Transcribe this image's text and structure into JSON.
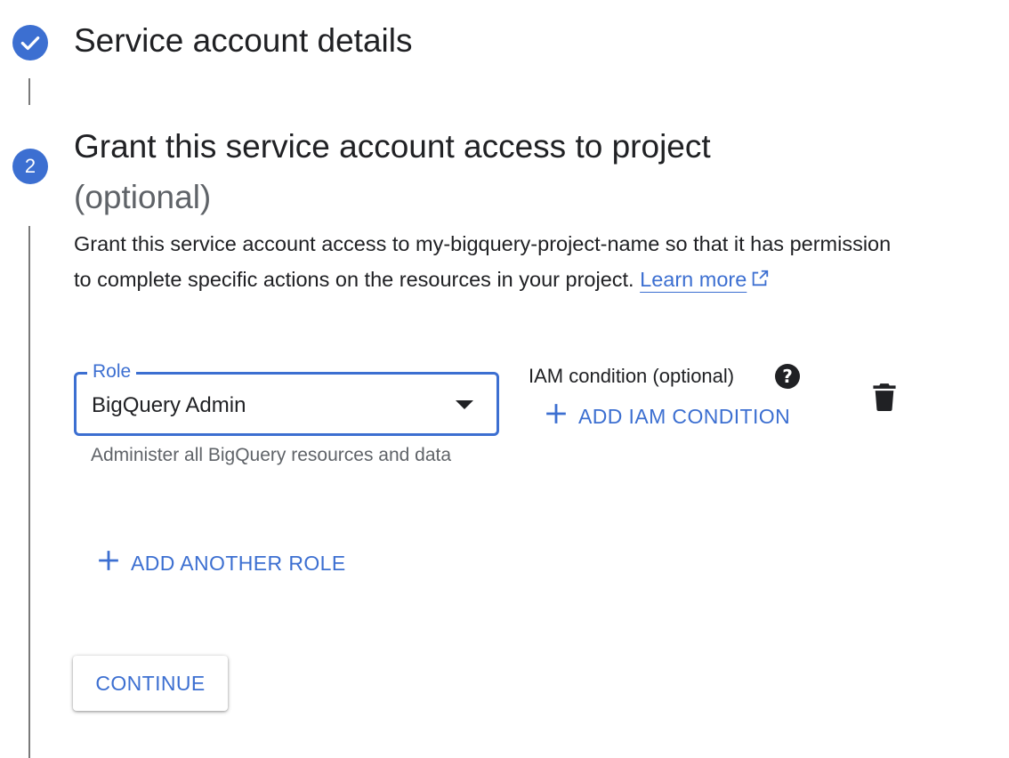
{
  "step1": {
    "title": "Service account details",
    "status_icon": "check-icon"
  },
  "step2": {
    "number": "2",
    "title": "Grant this service account access to project",
    "title_suffix": "(optional)",
    "description": "Grant this service account access to my-bigquery-project-name so that it has permission to complete specific actions on the resources in your project. ",
    "learn_more_label": "Learn more"
  },
  "role": {
    "label": "Role",
    "value": "BigQuery Admin",
    "helper_text": "Administer all BigQuery resources and data"
  },
  "iam_condition": {
    "label": "IAM condition (optional)",
    "add_label": "ADD IAM CONDITION",
    "help_icon": "?"
  },
  "add_another_role_label": "ADD ANOTHER ROLE",
  "continue_label": "CONTINUE",
  "colors": {
    "accent": "#3c6fd1",
    "text": "#202124",
    "secondary_text": "#5f6368",
    "connector": "#7a7a7a"
  }
}
